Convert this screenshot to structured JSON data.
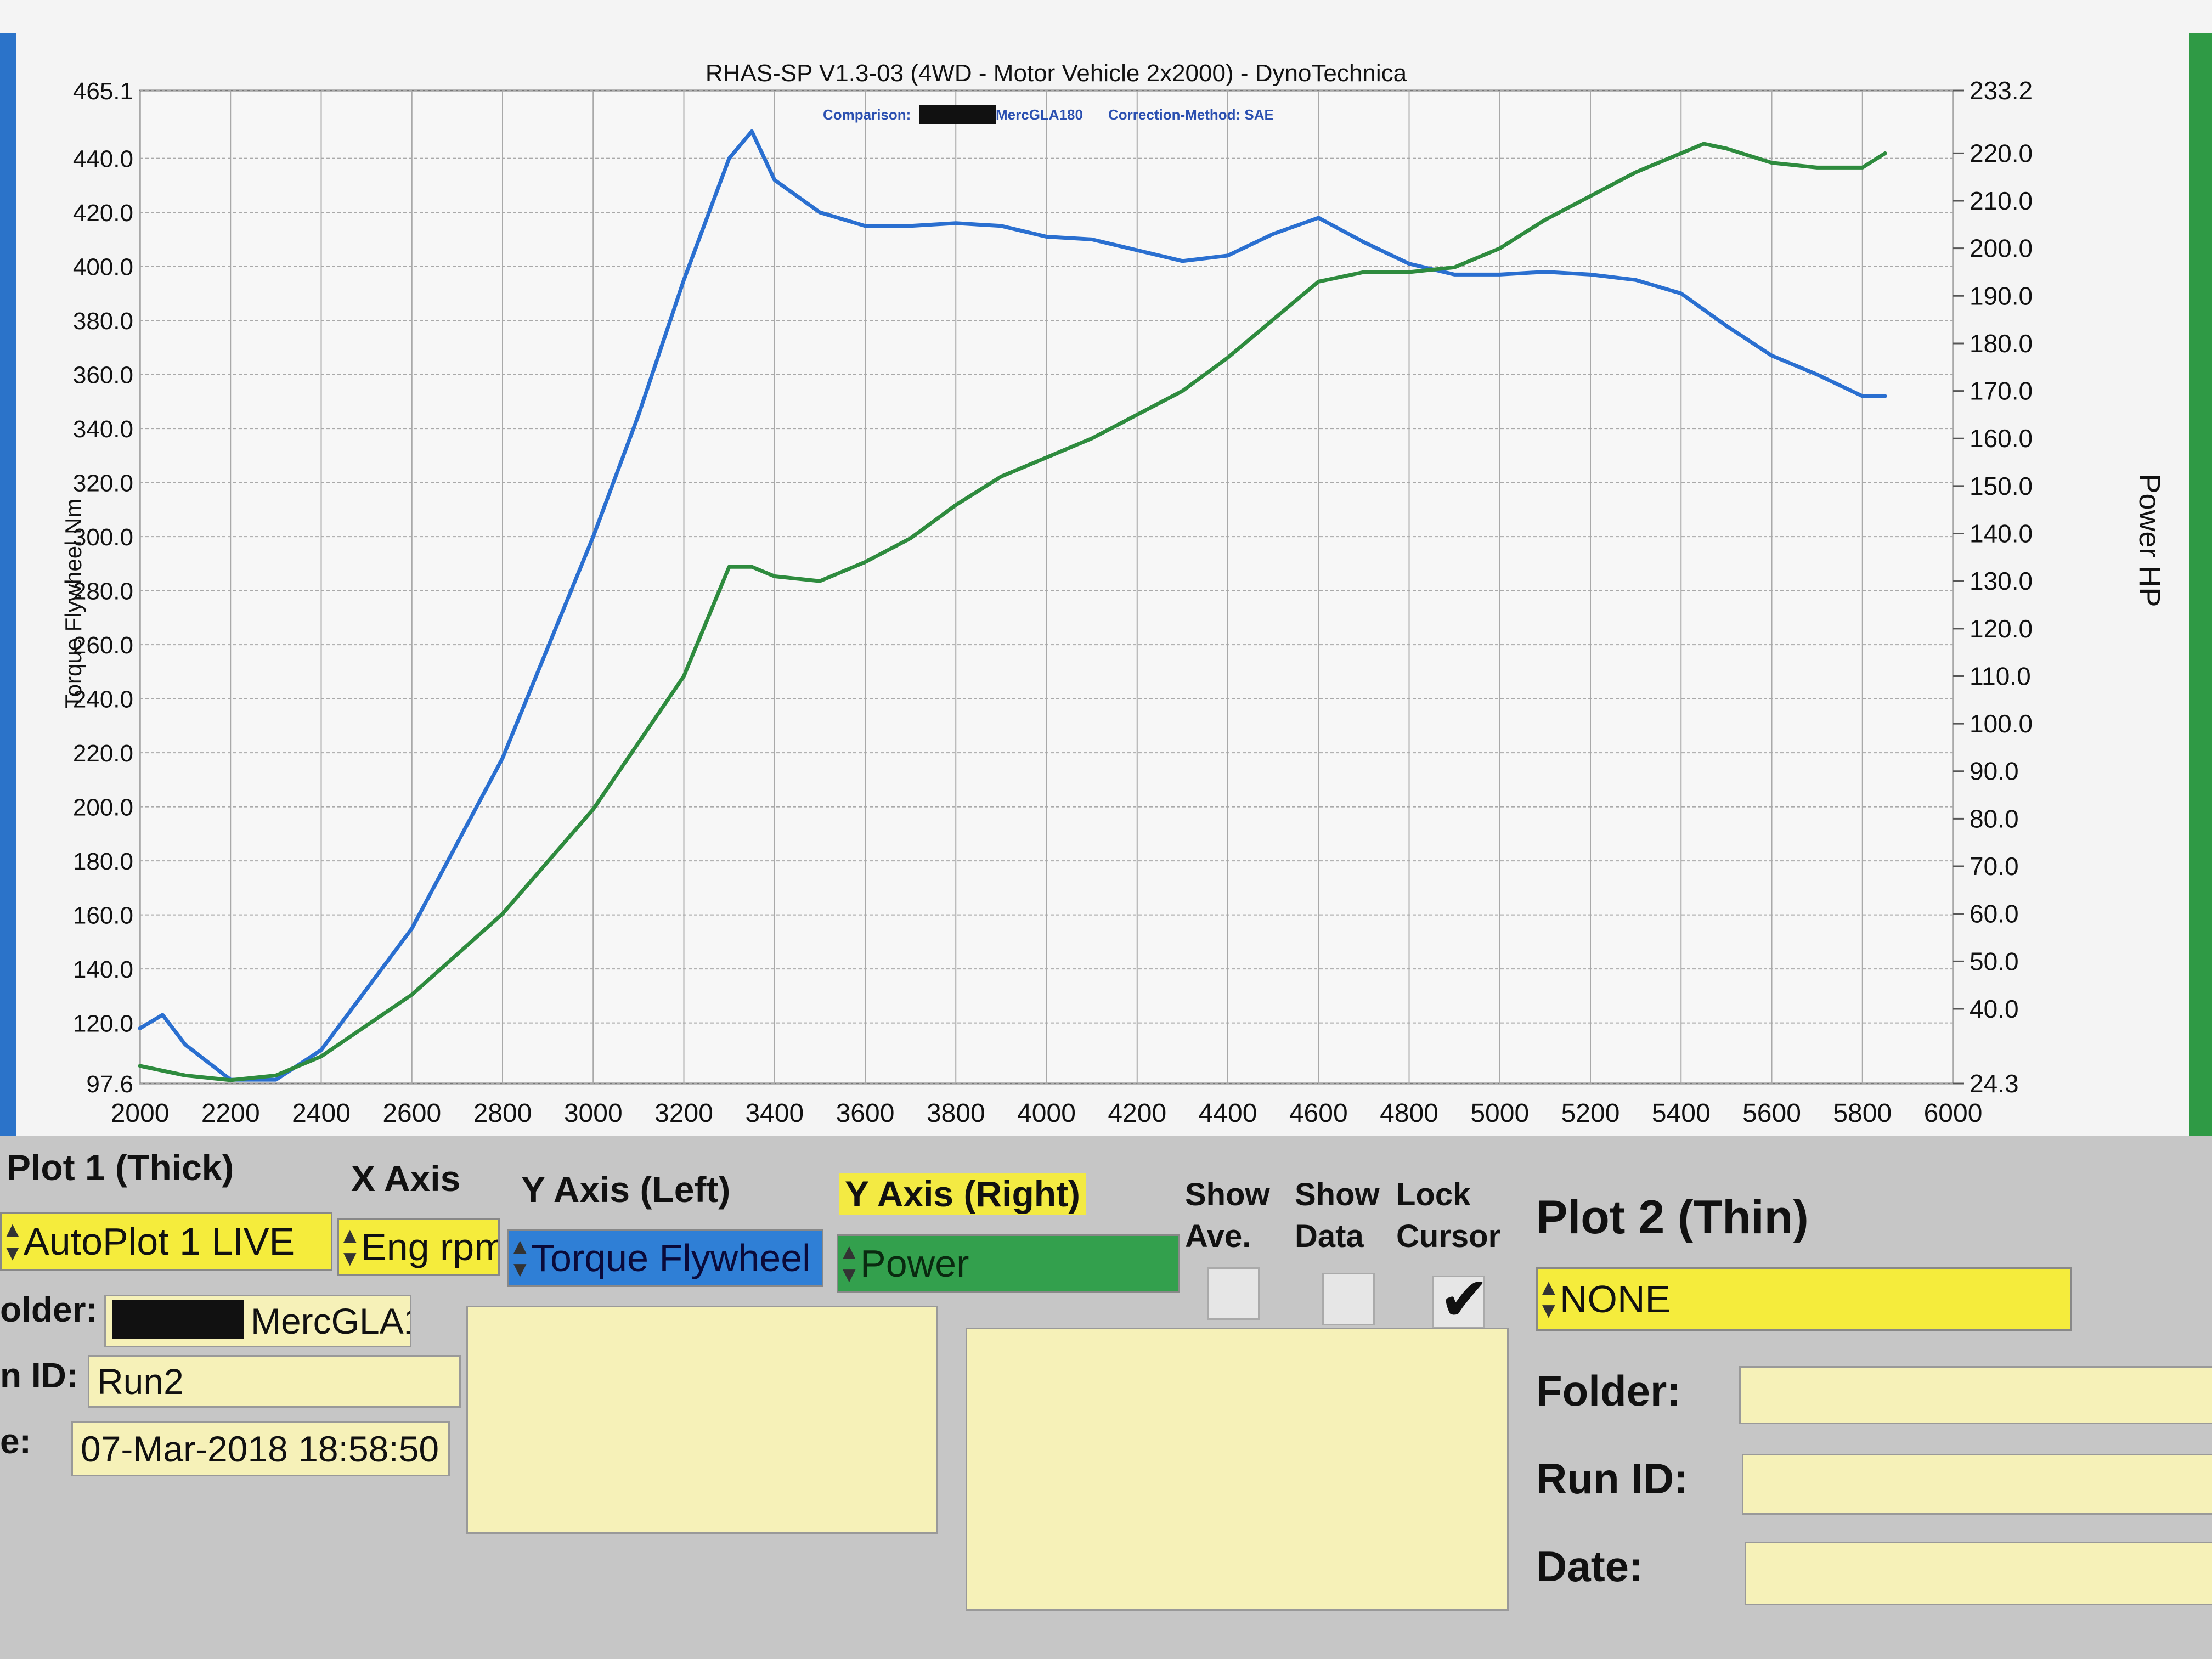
{
  "chart": {
    "title": "RHAS-SP V1.3-03  (4WD - Motor Vehicle 2x2000) - DynoTechnica",
    "comparison_label": "Comparison:",
    "comparison_value": "MercGLA180",
    "correction_label": "Correction-Method: SAE",
    "y_left_label": "Torque Flywheel Nm",
    "y_right_label": "Power HP",
    "y_left_ticks": [
      "465.1",
      "440.0",
      "420.0",
      "400.0",
      "380.0",
      "360.0",
      "340.0",
      "320.0",
      "300.0",
      "280.0",
      "260.0",
      "240.0",
      "220.0",
      "200.0",
      "180.0",
      "160.0",
      "140.0",
      "120.0",
      "97.6"
    ],
    "y_right_ticks": [
      "233.2",
      "220.0",
      "210.0",
      "200.0",
      "190.0",
      "180.0",
      "170.0",
      "160.0",
      "150.0",
      "140.0",
      "130.0",
      "120.0",
      "110.0",
      "100.0",
      "90.0",
      "80.0",
      "70.0",
      "60.0",
      "50.0",
      "40.0",
      "24.3"
    ],
    "x_ticks": [
      "2000",
      "2200",
      "2400",
      "2600",
      "2800",
      "3000",
      "3200",
      "3400",
      "3600",
      "3800",
      "4000",
      "4200",
      "4400",
      "4600",
      "4800",
      "5000",
      "5200",
      "5400",
      "5600",
      "5800",
      "6000"
    ],
    "colors": {
      "torque": "#2a6fd0",
      "power": "#2e8b3e",
      "grid": "#a9a9a9"
    }
  },
  "chart_data": {
    "type": "line",
    "x_label": "",
    "x_range": [
      2000,
      6000
    ],
    "y_left_range": [
      97.6,
      465.1
    ],
    "y_right_range": [
      24.3,
      233.2
    ],
    "grid": true,
    "series": [
      {
        "name": "Torque Flywheel",
        "axis": "left",
        "x": [
          2000,
          2050,
          2100,
          2200,
          2300,
          2400,
          2600,
          2800,
          3000,
          3100,
          3200,
          3300,
          3350,
          3400,
          3500,
          3600,
          3700,
          3800,
          3900,
          4000,
          4100,
          4200,
          4300,
          4400,
          4500,
          4600,
          4700,
          4800,
          4900,
          5000,
          5100,
          5200,
          5300,
          5400,
          5500,
          5600,
          5700,
          5800,
          5850
        ],
        "y": [
          118,
          123,
          112,
          99,
          99,
          110,
          155,
          218,
          300,
          345,
          395,
          440,
          450,
          432,
          420,
          415,
          415,
          416,
          415,
          411,
          410,
          406,
          402,
          404,
          412,
          418,
          409,
          401,
          397,
          397,
          398,
          397,
          395,
          390,
          378,
          367,
          360,
          352,
          352
        ]
      },
      {
        "name": "Power",
        "axis": "right",
        "x": [
          2000,
          2100,
          2200,
          2300,
          2400,
          2600,
          2800,
          3000,
          3200,
          3300,
          3350,
          3400,
          3500,
          3600,
          3700,
          3800,
          3900,
          4000,
          4100,
          4200,
          4300,
          4400,
          4500,
          4600,
          4700,
          4800,
          4900,
          5000,
          5100,
          5200,
          5300,
          5400,
          5450,
          5500,
          5600,
          5700,
          5800,
          5850
        ],
        "y": [
          28,
          26,
          25,
          26,
          30,
          43,
          60,
          82,
          110,
          133,
          133,
          131,
          130,
          134,
          139,
          146,
          152,
          156,
          160,
          165,
          170,
          177,
          185,
          193,
          195,
          195,
          196,
          200,
          206,
          211,
          216,
          220,
          222,
          221,
          218,
          217,
          217,
          220
        ]
      }
    ]
  },
  "panel": {
    "plot1_title": "Plot 1 (Thick)",
    "x_axis_title": "X Axis",
    "y_left_title": "Y Axis (Left)",
    "y_right_title": "Y Axis (Right)",
    "show_ave_label": "Show Ave.",
    "show_data_label": "Show Data",
    "lock_cursor_label": "Lock Cursor",
    "plot2_title": "Plot 2 (Thin)",
    "plot1_select": "AutoPlot 1 LIVE",
    "x_axis_select": "Eng rpm",
    "y_left_select": "Torque Flywheel",
    "y_right_select": "Power",
    "plot2_select": "NONE",
    "folder_label": "older:",
    "folder_value": "MercGLA1â",
    "run_id_label": "n ID:",
    "run_id_value": "Run2",
    "date_label": "e:",
    "date_value": "07-Mar-2018  18:58:50",
    "plot2_folder_label": "Folder:",
    "plot2_run_id_label": "Run ID:",
    "plot2_date_label": "Date:",
    "show_ave_checked": false,
    "show_data_checked": false,
    "lock_cursor_checked": true
  }
}
